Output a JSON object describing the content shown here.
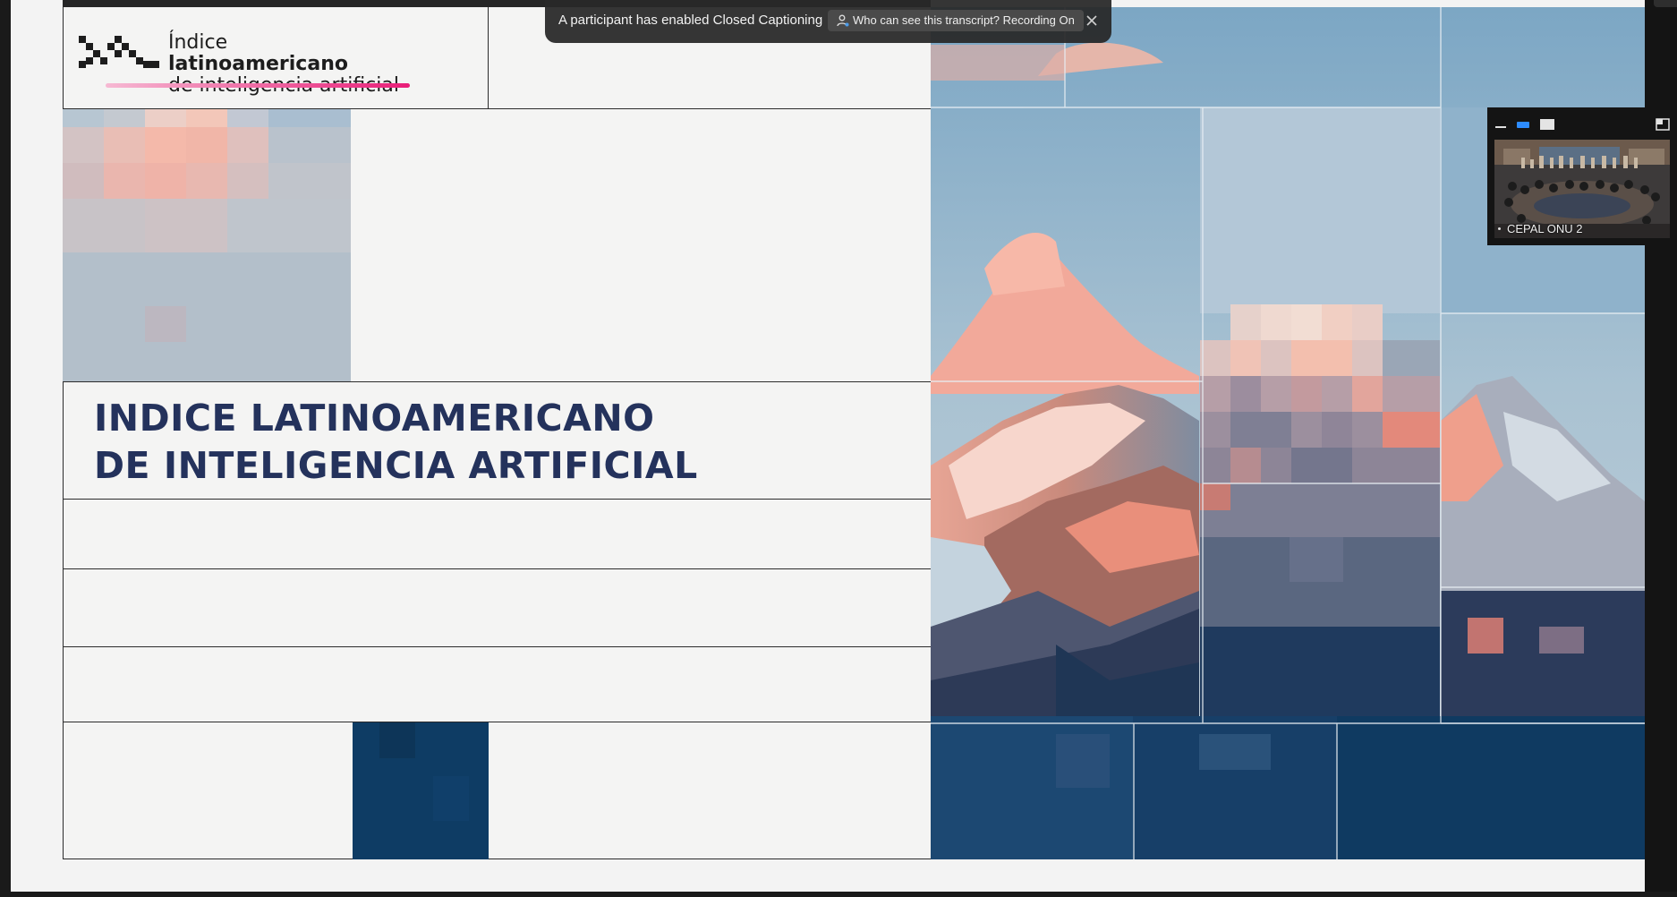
{
  "slide": {
    "logo": {
      "line1_light": "Índice ",
      "line1_bold": "latinoamericano",
      "line2": "de inteligencia artificial"
    },
    "title_line1": "INDICE LATINOAMERICANO",
    "title_line2": "DE INTELIGENCIA ARTIFICIAL"
  },
  "banner": {
    "message": "A participant has enabled Closed Captioning",
    "link": "Who can see this transcript? Recording On"
  },
  "pip": {
    "participant_name": "CEPAL ONU 2"
  },
  "colors": {
    "title": "#24325c",
    "navy": "#0e3c64",
    "accent_pink": "#e91d78"
  },
  "icons": [
    "logo-mark-icon",
    "person-icon",
    "close-icon",
    "minimize-icon",
    "camera-icon",
    "screen-icon",
    "expand-icon"
  ]
}
